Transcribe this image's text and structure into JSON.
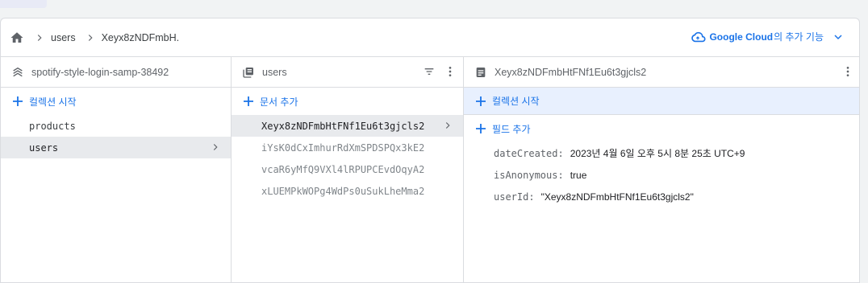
{
  "breadcrumb": {
    "items": [
      "users",
      "Xeyx8zNDFmbH."
    ]
  },
  "gcloud": {
    "strong": "Google Cloud",
    "rest": "의 추가 기능"
  },
  "col1": {
    "title": "spotify-style-login-samp-38492",
    "add_label": "컬렉션 시작",
    "items": [
      "products",
      "users"
    ]
  },
  "col2": {
    "title": "users",
    "add_label": "문서 추가",
    "items": [
      "Xeyx8zNDFmbHtFNf1Eu6t3gjcls2",
      "iYsK0dCxImhurRdXmSPDSPQx3kE2",
      "vcaR6yMfQ9VXl4lRPUPCEvdOqyA2",
      "xLUEMPkWOPg4WdPs0uSukLheMma2"
    ]
  },
  "col3": {
    "title": "Xeyx8zNDFmbHtFNf1Eu6t3gjcls2",
    "add_collection_label": "컬렉션 시작",
    "add_field_label": "필드 추가",
    "fields": [
      {
        "key": "dateCreated",
        "value": "2023년 4월 6일 오후 5시 8분 25초 UTC+9"
      },
      {
        "key": "isAnonymous",
        "value": "true"
      },
      {
        "key": "userId",
        "value": "\"Xeyx8zNDFmbHtFNf1Eu6t3gjcls2\""
      }
    ]
  },
  "colors": {
    "accent": "#1a73e8",
    "selected_bg": "#e8eaed",
    "highlight_bg": "#e8f0fe"
  }
}
